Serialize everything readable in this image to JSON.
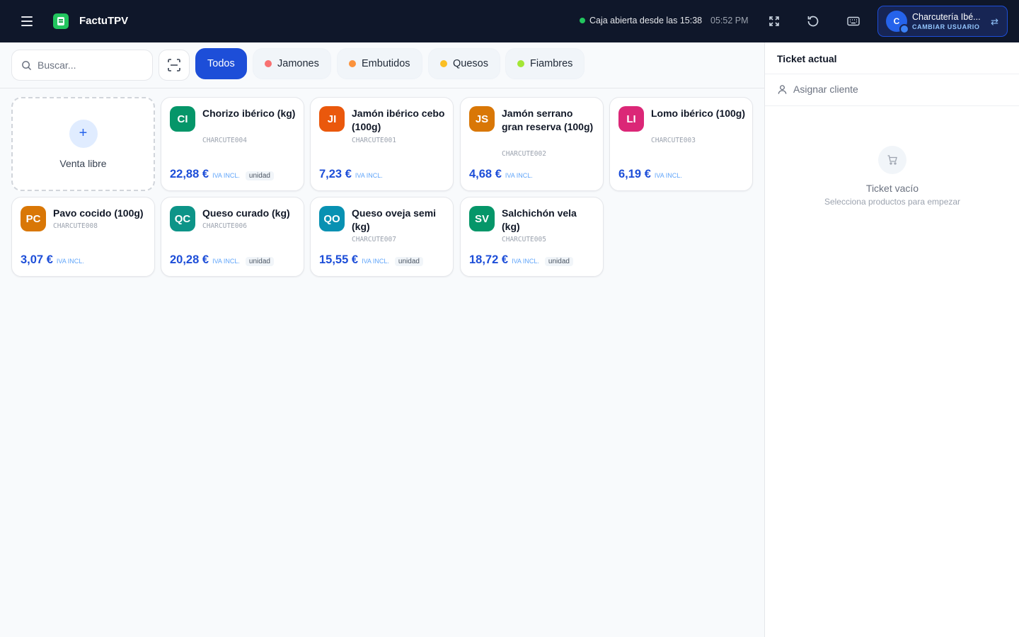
{
  "header": {
    "app_title": "FactuTPV",
    "status_text": "Caja abierta desde las 15:38",
    "clock": "05:52 PM",
    "user": {
      "name": "Charcutería Ibé...",
      "avatar_initial": "C",
      "action": "CAMBIAR USUARIO"
    },
    "icons": [
      "menu-icon",
      "app-logo-icon",
      "fullscreen-icon",
      "refresh-icon",
      "keyboard-icon",
      "swap-user-icon"
    ]
  },
  "search": {
    "placeholder": "Buscar..."
  },
  "categories": [
    {
      "label": "Todos",
      "active": true,
      "color": "#1d4ed8"
    },
    {
      "label": "Jamones",
      "active": false,
      "color": "#f87171"
    },
    {
      "label": "Embutidos",
      "active": false,
      "color": "#fb923c"
    },
    {
      "label": "Quesos",
      "active": false,
      "color": "#fbbf24"
    },
    {
      "label": "Fiambres",
      "active": false,
      "color": "#a3e635"
    }
  ],
  "free_sale": {
    "label": "Venta libre"
  },
  "products": [
    {
      "initials": "CI",
      "name": "Chorizo ibérico (kg)",
      "code": "CHARCUTE004",
      "price": "22,88 €",
      "tax": "IVA INCL.",
      "unit": "unidad",
      "color": "#059669"
    },
    {
      "initials": "JI",
      "name": "Jamón ibérico cebo (100g)",
      "code": "CHARCUTE001",
      "price": "7,23 €",
      "tax": "IVA INCL.",
      "unit": "",
      "color": "#ea580c"
    },
    {
      "initials": "JS",
      "name": "Jamón serrano gran reserva (100g)",
      "code": "CHARCUTE002",
      "price": "4,68 €",
      "tax": "IVA INCL.",
      "unit": "",
      "color": "#d97706"
    },
    {
      "initials": "LI",
      "name": "Lomo ibérico (100g)",
      "code": "CHARCUTE003",
      "price": "6,19 €",
      "tax": "IVA INCL.",
      "unit": "",
      "color": "#db2777"
    },
    {
      "initials": "PC",
      "name": "Pavo cocido (100g)",
      "code": "CHARCUTE008",
      "price": "3,07 €",
      "tax": "IVA INCL.",
      "unit": "",
      "color": "#d97706"
    },
    {
      "initials": "QC",
      "name": "Queso curado (kg)",
      "code": "CHARCUTE006",
      "price": "20,28 €",
      "tax": "IVA INCL.",
      "unit": "unidad",
      "color": "#0d9488"
    },
    {
      "initials": "QO",
      "name": "Queso oveja semi (kg)",
      "code": "CHARCUTE007",
      "price": "15,55 €",
      "tax": "IVA INCL.",
      "unit": "unidad",
      "color": "#0891b2"
    },
    {
      "initials": "SV",
      "name": "Salchichón vela (kg)",
      "code": "CHARCUTE005",
      "price": "18,72 €",
      "tax": "IVA INCL.",
      "unit": "unidad",
      "color": "#059669"
    }
  ],
  "ticket": {
    "title": "Ticket actual",
    "assign_client": "Asignar cliente",
    "empty_title": "Ticket vacío",
    "empty_subtitle": "Selecciona productos para empezar"
  }
}
